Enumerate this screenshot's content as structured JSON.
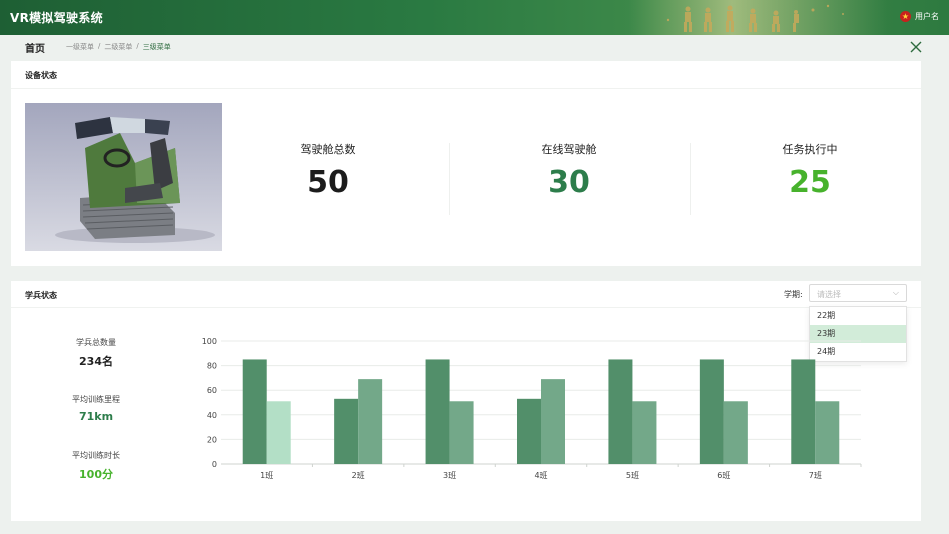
{
  "header": {
    "title": "VR模拟驾驶系统",
    "username": "用户名"
  },
  "breadcrumb": {
    "home": "首页",
    "items": [
      "一级菜单",
      "二级菜单",
      "三级菜单"
    ],
    "sep": "/"
  },
  "device_status": {
    "title": "设备状态",
    "stats": [
      {
        "label": "驾驶舱总数",
        "value": "50"
      },
      {
        "label": "在线驾驶舱",
        "value": "30"
      },
      {
        "label": "任务执行中",
        "value": "25"
      }
    ]
  },
  "student_status": {
    "title": "学兵状态",
    "period_label": "学期:",
    "period_placeholder": "请选择",
    "period_options": [
      "22期",
      "23期",
      "24期"
    ],
    "highlighted_option": "23期",
    "summary": [
      {
        "label": "学兵总数量",
        "value": "234名"
      },
      {
        "label": "平均训练里程",
        "value": "71km"
      },
      {
        "label": "平均训练时长",
        "value": "100分"
      }
    ]
  },
  "colors": {
    "header_green": "#2a7a42",
    "bar_dark": "#528f6a",
    "bar_light_1": "#b3dfc6",
    "bar_light": "#73a889",
    "accent_green": "#47b22c"
  },
  "chart_data": {
    "type": "bar",
    "categories": [
      "1班",
      "2班",
      "3班",
      "4班",
      "5班",
      "6班",
      "7班"
    ],
    "series": [
      {
        "values": [
          85,
          53,
          85,
          53,
          85,
          85,
          85
        ]
      },
      {
        "values": [
          51,
          69,
          51,
          69,
          51,
          51,
          51
        ]
      }
    ],
    "yticks": [
      "0",
      "20",
      "40",
      "60",
      "80",
      "100"
    ],
    "ylim": [
      0,
      100
    ],
    "grid": true
  }
}
